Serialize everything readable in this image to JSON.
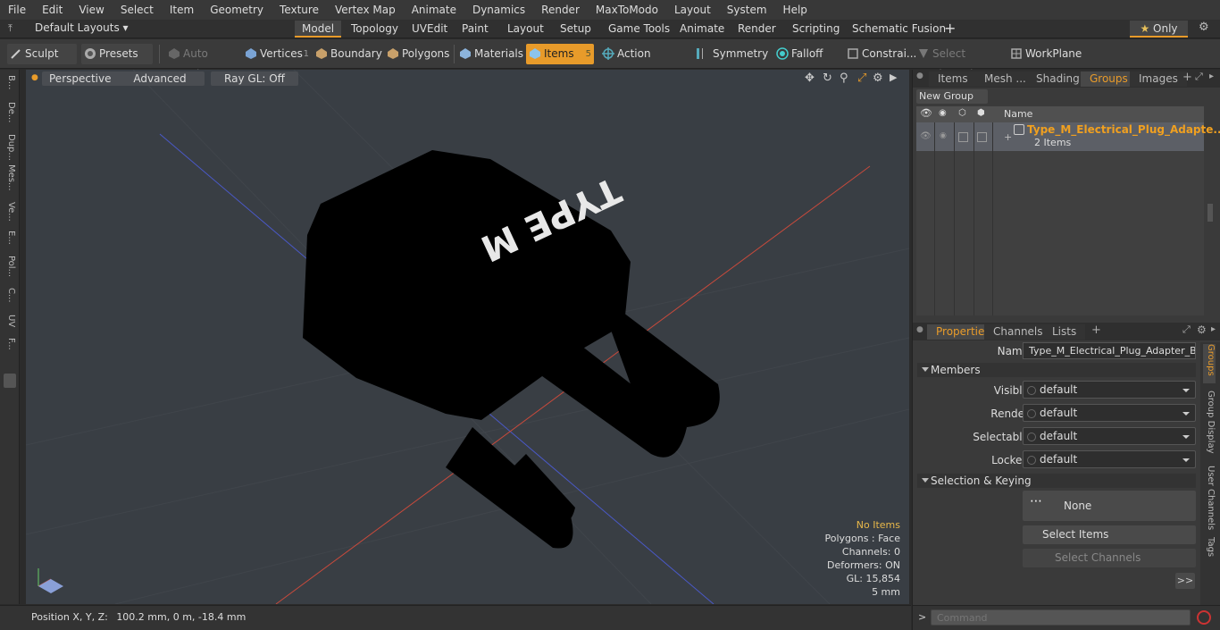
{
  "menu": [
    "File",
    "Edit",
    "View",
    "Select",
    "Item",
    "Geometry",
    "Texture",
    "Vertex Map",
    "Animate",
    "Dynamics",
    "Render",
    "MaxToModo",
    "Layout",
    "System",
    "Help"
  ],
  "layout": {
    "preset_label": "Default Layouts",
    "tabs": [
      "Model",
      "Topology",
      "UVEdit",
      "Paint",
      "Layout",
      "Setup",
      "Game Tools",
      "Animate",
      "Render",
      "Scripting",
      "Schematic Fusion"
    ],
    "active_tab": "Model",
    "only_label": "Only"
  },
  "toolbar": {
    "sculpt": "Sculpt",
    "presets": "Presets",
    "auto_select": "Auto Select",
    "vertices": "Vertices",
    "vertices_count": "1",
    "boundary": "Boundary",
    "polygons": "Polygons",
    "materials": "Materials",
    "items": "Items",
    "items_count": "5",
    "action_center": "Action Center",
    "symmetry": "Symmetry",
    "falloff": "Falloff",
    "constraints": "Constrai...",
    "select_through": "Select Through",
    "workplane": "WorkPlane"
  },
  "left_tabs": [
    "B...",
    "De...",
    "Dup...",
    "Mes...",
    "Ve...",
    "E...",
    "Pol...",
    "C...",
    "UV",
    "F..."
  ],
  "viewport": {
    "perspective": "Perspective",
    "advanced": "Advanced",
    "raygl": "Ray GL: Off",
    "model_label": "TYPE M",
    "stats": {
      "items": "No Items",
      "polygons": "Polygons : Face",
      "channels": "Channels: 0",
      "deformers": "Deformers: ON",
      "gl": "GL: 15,854",
      "unit": "5 mm"
    }
  },
  "status": {
    "position_label": "Position X, Y, Z:",
    "position_value": "100.2 mm, 0 m, -18.4 mm"
  },
  "groups_panel": {
    "tabs": [
      "Items",
      "Mesh ...",
      "Shading",
      "Groups",
      "Images"
    ],
    "active_tab": "Groups",
    "new_group": "New Group",
    "col_name": "Name",
    "group_name": "Type_M_Electrical_Plug_Adapte...",
    "group_count": "2 Items"
  },
  "properties": {
    "tabs": [
      "Properties",
      "Channels",
      "Lists"
    ],
    "name_label": "Name",
    "name_value": "Type_M_Electrical_Plug_Adapter_Blac",
    "members": "Members",
    "visible_label": "Visible",
    "visible_value": "default",
    "render_label": "Render",
    "render_value": "default",
    "selectable_label": "Selectable",
    "selectable_value": "default",
    "locked_label": "Locked",
    "locked_value": "default",
    "sel_keying": "Selection & Keying",
    "none": "None",
    "select_items": "Select Items",
    "select_channels": "Select Channels",
    "more": ">>",
    "side_tabs": [
      "Groups",
      "Group Display",
      "User Channels",
      "Tags"
    ]
  },
  "command": {
    "placeholder": "Command",
    "prompt": ">"
  },
  "colors": {
    "accent": "#e89b2a",
    "viewport_bg": "#393e44"
  }
}
